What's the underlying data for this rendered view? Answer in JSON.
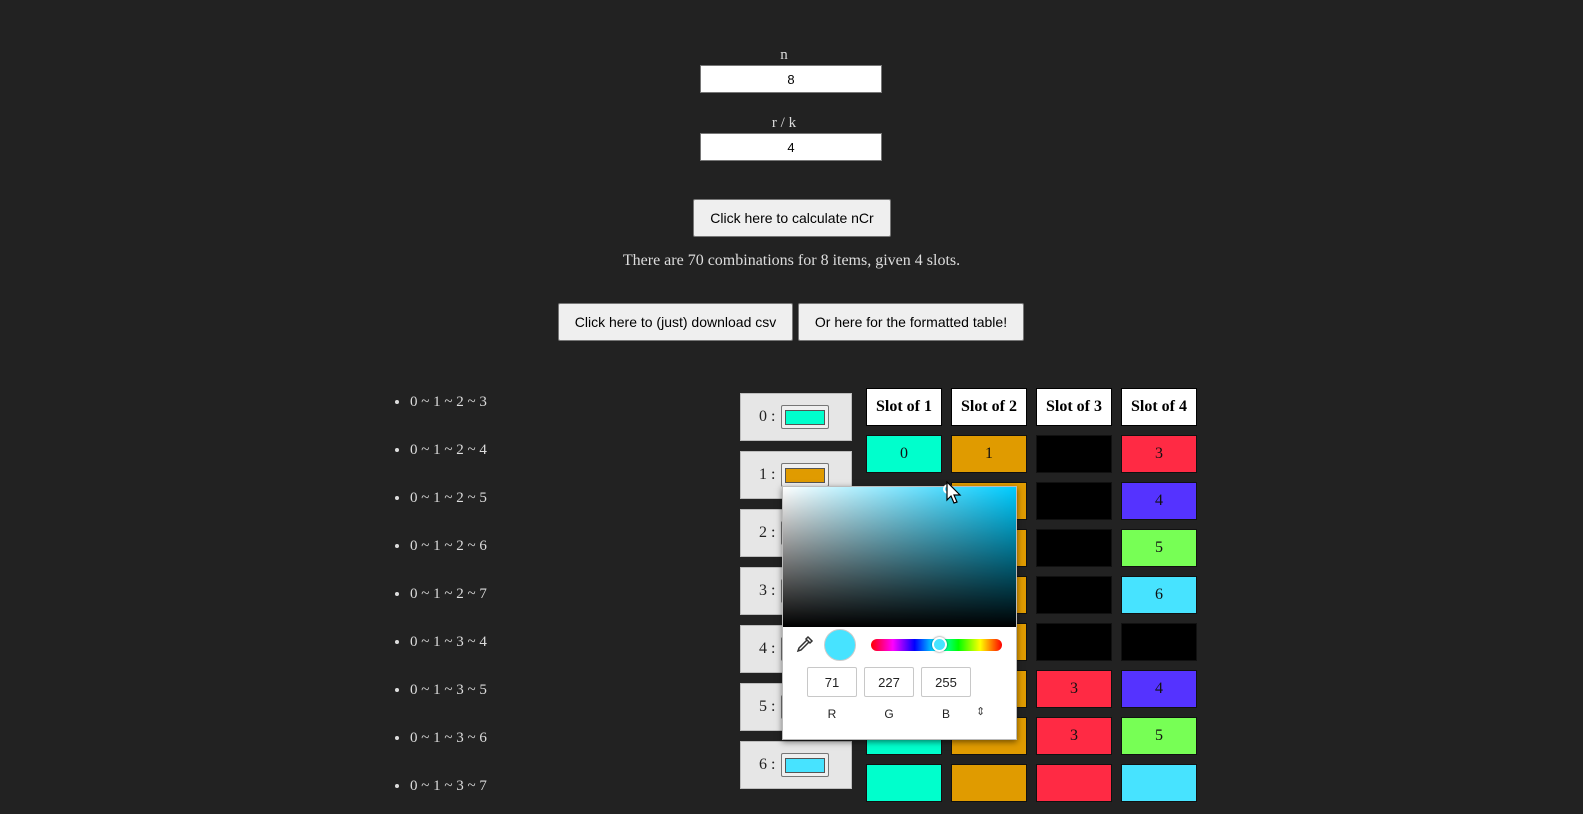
{
  "form": {
    "n_label": "n",
    "n_value": "8",
    "r_label": "r / k",
    "r_value": "4",
    "calc_button": "Click here to calculate nCr"
  },
  "result_text": "There are 70 combinations for 8 items, given 4 slots.",
  "actions": {
    "download_csv": "Click here to (just) download csv",
    "formatted_table": "Or here for the formatted table!"
  },
  "combinations": [
    "0 ~ 1 ~ 2 ~ 3",
    "0 ~ 1 ~ 2 ~ 4",
    "0 ~ 1 ~ 2 ~ 5",
    "0 ~ 1 ~ 2 ~ 6",
    "0 ~ 1 ~ 2 ~ 7",
    "0 ~ 1 ~ 3 ~ 4",
    "0 ~ 1 ~ 3 ~ 5",
    "0 ~ 1 ~ 3 ~ 6",
    "0 ~ 1 ~ 3 ~ 7"
  ],
  "color_rows": [
    {
      "label": "0 :",
      "color": "#00ffcc"
    },
    {
      "label": "1 :",
      "color": "#e09b00"
    },
    {
      "label": "2 :",
      "color": ""
    },
    {
      "label": "3 :",
      "color": ""
    },
    {
      "label": "4 :",
      "color": ""
    },
    {
      "label": "5 :",
      "color": ""
    },
    {
      "label": "6 :",
      "color": "#47e3ff"
    }
  ],
  "table": {
    "headers": [
      "Slot of 1",
      "Slot of 2",
      "Slot of 3",
      "Slot of 4"
    ],
    "rows": [
      [
        {
          "v": "0",
          "c": "#00ffcc"
        },
        {
          "v": "1",
          "c": "#e09b00"
        },
        {
          "v": "",
          "c": "#000000"
        },
        {
          "v": "3",
          "c": "#ff2a44"
        }
      ],
      [
        {
          "v": "",
          "c": ""
        },
        {
          "v": "",
          "c": "#e09b00"
        },
        {
          "v": "",
          "c": "#000000"
        },
        {
          "v": "4",
          "c": "#5533ff"
        }
      ],
      [
        {
          "v": "",
          "c": ""
        },
        {
          "v": "",
          "c": "#e09b00"
        },
        {
          "v": "",
          "c": "#000000"
        },
        {
          "v": "5",
          "c": "#77ff55"
        }
      ],
      [
        {
          "v": "",
          "c": ""
        },
        {
          "v": "",
          "c": "#e09b00"
        },
        {
          "v": "",
          "c": "#000000"
        },
        {
          "v": "6",
          "c": "#47e3ff"
        }
      ],
      [
        {
          "v": "",
          "c": ""
        },
        {
          "v": "",
          "c": "#e09b00"
        },
        {
          "v": "",
          "c": "#000000"
        },
        {
          "v": "",
          "c": "#000000"
        }
      ],
      [
        {
          "v": "",
          "c": ""
        },
        {
          "v": "",
          "c": "#e09b00"
        },
        {
          "v": "3",
          "c": "#ff2a44"
        },
        {
          "v": "4",
          "c": "#5533ff"
        }
      ],
      [
        {
          "v": "0",
          "c": "#00ffcc"
        },
        {
          "v": "1",
          "c": "#e09b00"
        },
        {
          "v": "3",
          "c": "#ff2a44"
        },
        {
          "v": "5",
          "c": "#77ff55"
        }
      ],
      [
        {
          "v": "",
          "c": "#00ffcc"
        },
        {
          "v": "",
          "c": "#e09b00"
        },
        {
          "v": "",
          "c": "#ff2a44"
        },
        {
          "v": "",
          "c": "#47e3ff"
        }
      ]
    ]
  },
  "picker": {
    "hue_color": "#00ccff",
    "preview_color": "#47e3ff",
    "r": "71",
    "g": "227",
    "b": "255",
    "r_label": "R",
    "g_label": "G",
    "b_label": "B",
    "spin_glyph": "⇕",
    "hue_fraction": 0.52
  }
}
